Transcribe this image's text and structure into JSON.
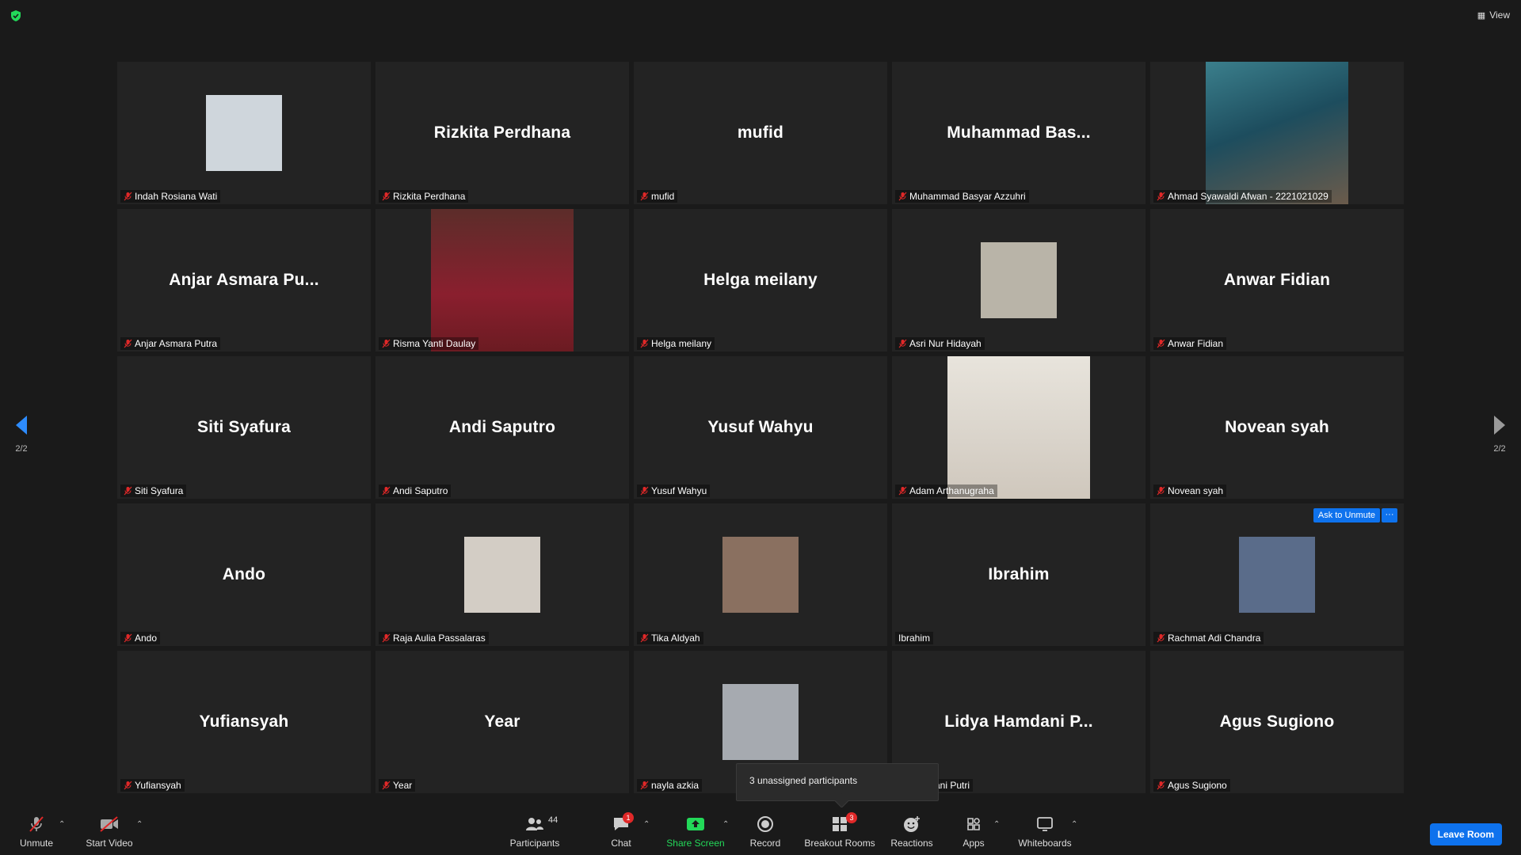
{
  "topbar": {
    "view_label": "View"
  },
  "tiles": [
    {
      "display": "",
      "label": "Indah Rosiana Wati",
      "visual": "avatar"
    },
    {
      "display": "Rizkita Perdhana",
      "label": "Rizkita Perdhana",
      "visual": "name"
    },
    {
      "display": "mufid",
      "label": "mufid",
      "visual": "name"
    },
    {
      "display": "Muhammad  Bas...",
      "label": "Muhammad Basyar Azzuhri",
      "visual": "name"
    },
    {
      "display": "",
      "label": "Ahmad Syawaldi Afwan - 2221021029",
      "visual": "photo"
    },
    {
      "display": "Anjar Asmara Pu...",
      "label": "Anjar Asmara Putra",
      "visual": "name"
    },
    {
      "display": "",
      "label": "Risma Yanti Daulay",
      "visual": "photo"
    },
    {
      "display": "Helga meilany",
      "label": "Helga meilany",
      "visual": "name"
    },
    {
      "display": "",
      "label": "Asri Nur Hidayah",
      "visual": "avatar"
    },
    {
      "display": "Anwar Fidian",
      "label": "Anwar Fidian",
      "visual": "name"
    },
    {
      "display": "Siti Syafura",
      "label": "Siti Syafura",
      "visual": "name"
    },
    {
      "display": "Andi Saputro",
      "label": "Andi Saputro",
      "visual": "name"
    },
    {
      "display": "Yusuf Wahyu",
      "label": "Yusuf Wahyu",
      "visual": "name"
    },
    {
      "display": "",
      "label": "Adam Arthanugraha",
      "visual": "photo"
    },
    {
      "display": "Novean syah",
      "label": "Novean syah",
      "visual": "name"
    },
    {
      "display": "Ando",
      "label": "Ando",
      "visual": "name"
    },
    {
      "display": "",
      "label": "Raja Aulia Passalaras",
      "visual": "avatar"
    },
    {
      "display": "",
      "label": "Tika Aldyah",
      "visual": "avatar"
    },
    {
      "display": "Ibrahim",
      "label": "Ibrahim",
      "visual": "name"
    },
    {
      "display": "",
      "label": "Rachmat Adi Chandra",
      "visual": "avatar"
    },
    {
      "display": "Yufiansyah",
      "label": "Yufiansyah",
      "visual": "name"
    },
    {
      "display": "Year",
      "label": "Year",
      "visual": "name"
    },
    {
      "display": "",
      "label": "nayla azkia",
      "visual": "avatar"
    },
    {
      "display": "Lidya Hamdani P...",
      "label": "Hamdani Putri",
      "visual": "name"
    },
    {
      "display": "Agus Sugiono",
      "label": "Agus Sugiono",
      "visual": "name"
    }
  ],
  "tile_actions": {
    "ask_to_unmute": "Ask to Unmute",
    "more": "···"
  },
  "pagination": {
    "left": "2/2",
    "right": "2/2"
  },
  "tooltip": {
    "text": "3 unassigned participants"
  },
  "toolbar": {
    "unmute": "Unmute",
    "start_video": "Start Video",
    "participants": "Participants",
    "participants_count": "44",
    "chat": "Chat",
    "chat_badge": "1",
    "share_screen": "Share Screen",
    "record": "Record",
    "breakout_rooms": "Breakout Rooms",
    "breakout_badge": "3",
    "reactions": "Reactions",
    "apps": "Apps",
    "whiteboards": "Whiteboards",
    "leave_room": "Leave Room"
  },
  "colors": {
    "accent": "#0e72ed",
    "muted_red": "#e02828",
    "share_green": "#23d959",
    "bg": "#1a1a1a",
    "tile": "#232323"
  }
}
